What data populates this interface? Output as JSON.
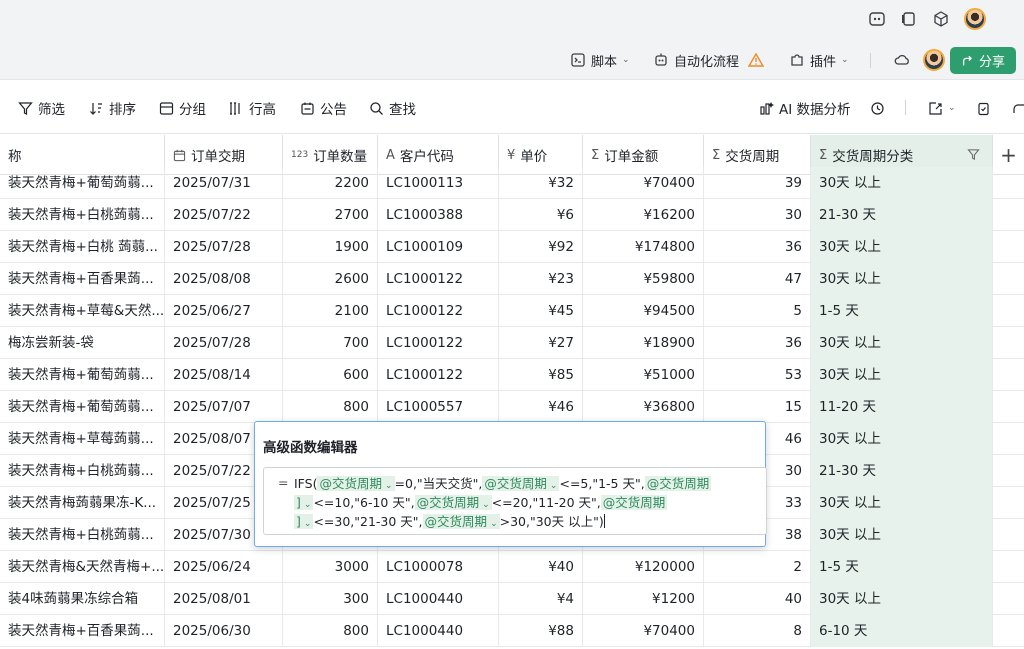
{
  "bar2": {
    "script_label": "脚本",
    "automation_label": "自动化流程",
    "plugins_label": "插件",
    "share_label": "分享"
  },
  "toolbar": {
    "filter_label": "筛选",
    "sort_label": "排序",
    "group_label": "分组",
    "row_height_label": "行高",
    "announce_label": "公告",
    "search_label": "查找",
    "ai_label": "AI 数据分析"
  },
  "columns": [
    {
      "label": "称",
      "icon": ""
    },
    {
      "label": "订单交期",
      "icon": "calendar-icon"
    },
    {
      "label": "订单数量",
      "icon": "123"
    },
    {
      "label": "客户代码",
      "icon": "A"
    },
    {
      "label": "单价",
      "icon": "¥"
    },
    {
      "label": "订单金额",
      "icon": "Σ"
    },
    {
      "label": "交货周期",
      "icon": "Σ"
    },
    {
      "label": "交货周期分类",
      "icon": "Σ"
    }
  ],
  "rows": [
    [
      "装天然青梅+葡萄蒟蒻...",
      "2025/07/31",
      "2200",
      "LC1000113",
      "¥32",
      "¥70400",
      "39",
      "30天 以上"
    ],
    [
      "装天然青梅+白桃蒟蒻...",
      "2025/07/22",
      "2700",
      "LC1000388",
      "¥6",
      "¥16200",
      "30",
      "21-30 天"
    ],
    [
      "装天然青梅+白桃 蒟蒻...",
      "2025/07/28",
      "1900",
      "LC1000109",
      "¥92",
      "¥174800",
      "36",
      "30天 以上"
    ],
    [
      "装天然青梅+百香果蒟...",
      "2025/08/08",
      "2600",
      "LC1000122",
      "¥23",
      "¥59800",
      "47",
      "30天 以上"
    ],
    [
      "装天然青梅+草莓&天然...",
      "2025/06/27",
      "2100",
      "LC1000122",
      "¥45",
      "¥94500",
      "5",
      "1-5 天"
    ],
    [
      "梅冻尝新装-袋",
      "2025/07/28",
      "700",
      "LC1000122",
      "¥27",
      "¥18900",
      "36",
      "30天 以上"
    ],
    [
      "装天然青梅+葡萄蒟蒻...",
      "2025/08/14",
      "600",
      "LC1000122",
      "¥85",
      "¥51000",
      "53",
      "30天 以上"
    ],
    [
      "装天然青梅+葡萄蒟蒻...",
      "2025/07/07",
      "800",
      "LC1000557",
      "¥46",
      "¥36800",
      "15",
      "11-20 天"
    ],
    [
      "装天然青梅+草莓蒟蒻...",
      "2025/08/07",
      "",
      "",
      "",
      "",
      "46",
      "30天 以上"
    ],
    [
      "装天然青梅+白桃蒟蒻...",
      "2025/07/22",
      "",
      "",
      "",
      "",
      "30",
      "21-30 天"
    ],
    [
      "装天然青梅蒟蒻果冻-K...",
      "2025/07/25",
      "",
      "",
      "",
      "",
      "33",
      "30天 以上"
    ],
    [
      "装天然青梅+白桃蒟蒻...",
      "2025/07/30",
      "",
      "",
      "",
      "",
      "38",
      "30天 以上"
    ],
    [
      "装天然青梅&天然青梅+...",
      "2025/06/24",
      "3000",
      "LC1000078",
      "¥40",
      "¥120000",
      "2",
      "1-5 天"
    ],
    [
      "装4味蒟蒻果冻综合箱",
      "2025/08/01",
      "300",
      "LC1000440",
      "¥4",
      "¥1200",
      "40",
      "30天 以上"
    ],
    [
      "装天然青梅+百香果蒟...",
      "2025/06/30",
      "800",
      "LC1000440",
      "¥88",
      "¥70400",
      "8",
      "6-10 天"
    ]
  ],
  "editor": {
    "title": "高级函数编辑器",
    "eq": "=",
    "field_token": "@交货周期",
    "line1": {
      "t0": "IFS(",
      "t1": "=0,\"当天交货\",",
      "t2": "<=5,\"1-5 天\","
    },
    "line2": {
      "t1": "<=10,\"6-10 天\",",
      "t2": "<=20,\"11-20 天\","
    },
    "line3": {
      "t1": "<=30,\"21-30 天\",",
      "t2": ">30,\"30天 以上\")"
    }
  },
  "colors": {
    "accent_green": "#2f9e6f",
    "category_column_bg": "#e7f2ec",
    "popup_border": "#6ea8f5",
    "warning_orange": "#f08a24"
  }
}
